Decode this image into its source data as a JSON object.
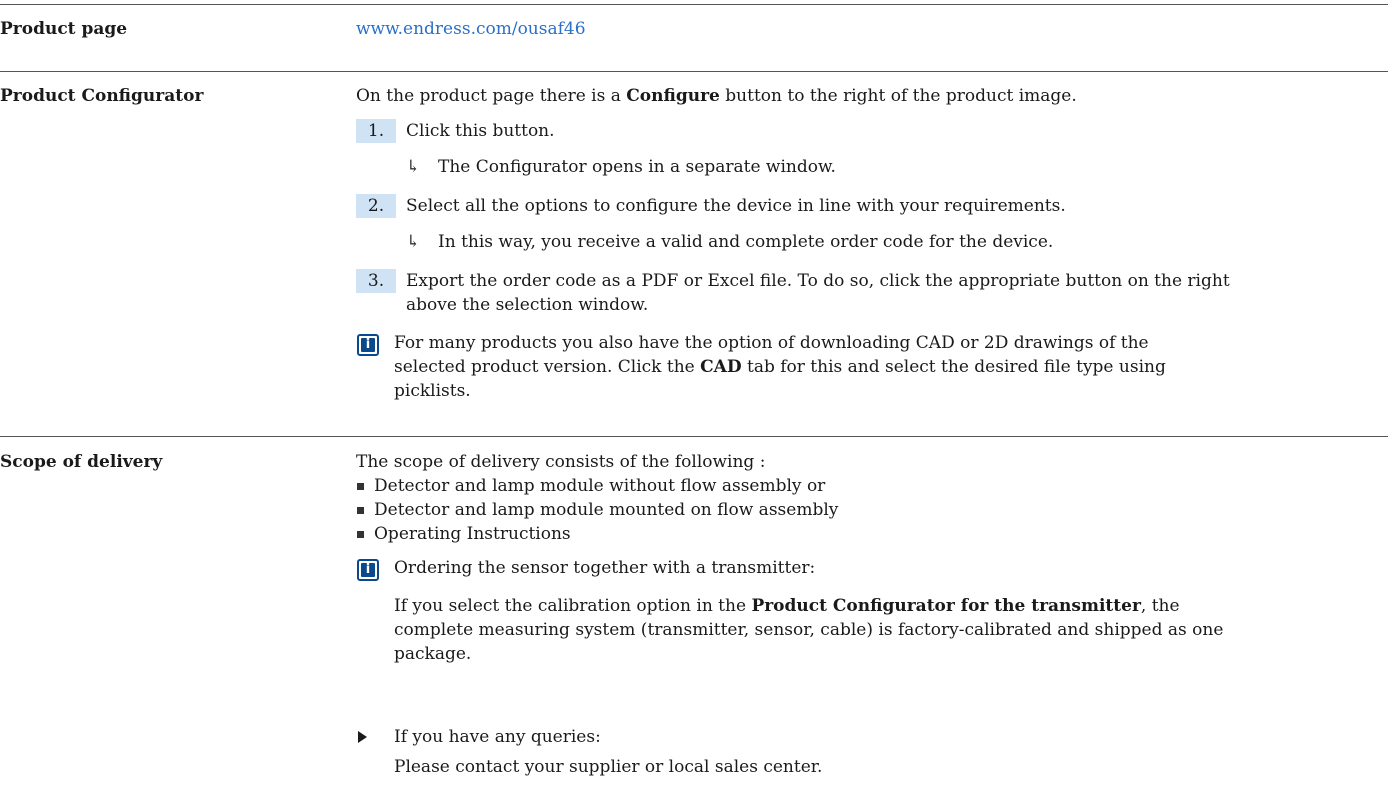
{
  "product_page": {
    "label": "Product page",
    "link": "www.endress.com/ousaf46"
  },
  "configurator": {
    "label": "Product Configurator",
    "intro_pre": "On the product page there is a ",
    "intro_bold": "Configure",
    "intro_post": " button to the right of the product image.",
    "steps": [
      {
        "num": "1.",
        "text": "Click this button.",
        "result": "The Configurator opens in a separate window."
      },
      {
        "num": "2.",
        "text": "Select all the options to configure the device in line with your requirements.",
        "result": "In this way, you receive a valid and complete order code for the device."
      },
      {
        "num": "3.",
        "text_line1": "Export the order code as a PDF or Excel file. To do so, click the appropriate button on the right",
        "text_line2": "above the selection window."
      }
    ],
    "note": {
      "line1": "For many products you also have the option of downloading CAD or 2D drawings of the",
      "line2_pre": "selected product version. Click the ",
      "line2_bold": "CAD",
      "line2_post": " tab for this and select the desired file type using",
      "line3": "picklists."
    }
  },
  "delivery": {
    "label": "Scope of delivery",
    "intro": "The scope of delivery consists of the following :",
    "bullets": [
      "Detector and lamp module without flow assembly or",
      "Detector and lamp module mounted on flow assembly",
      "Operating Instructions"
    ],
    "note_title": "Ordering the sensor together with a transmitter:",
    "note_body": {
      "line1_pre": "If you select the calibration option in the ",
      "line1_bold": "Product Configurator for the transmitter",
      "line1_post": ", the",
      "line2": "complete measuring system (transmitter, sensor, cable) is factory-calibrated and shipped as one",
      "line3": "package."
    },
    "action": "If you have any queries:",
    "action_detail": "Please contact your supplier or local sales center."
  },
  "colors": {
    "link": "#2a6fc9",
    "step_highlight": "#cfe3f4",
    "info_icon": "#0a4a8c"
  }
}
